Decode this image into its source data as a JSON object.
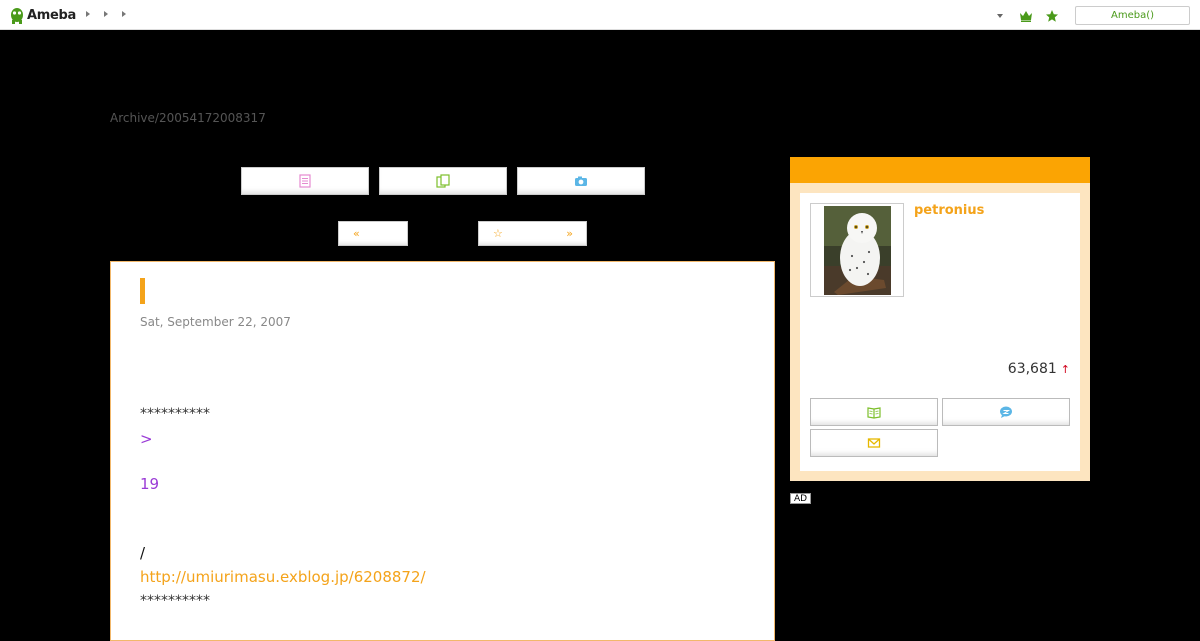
{
  "header": {
    "logo_text": "Ameba",
    "ameba_button_label": "Ameba()"
  },
  "archive": {
    "label": "Archive/20054172008317"
  },
  "toolbar": {
    "prev_label": "«",
    "next_star": "☆",
    "next_label": "»"
  },
  "article": {
    "date": "Sat, September 22, 2007",
    "separator_top": "**********",
    "quote_mark": ">",
    "number_line": "19",
    "slash_line": "/",
    "link_url": "http://umiurimasu.exblog.jp/6208872/",
    "separator_bottom": "**********"
  },
  "profile": {
    "name": "petronius",
    "rank": "63,681",
    "rank_trend": "↑"
  },
  "ad": {
    "label": "AD"
  },
  "colors": {
    "accent_orange": "#fba403",
    "link_orange": "#f4a31a",
    "purple_text": "#9a3bd6",
    "profile_bg": "#fde5c0"
  }
}
